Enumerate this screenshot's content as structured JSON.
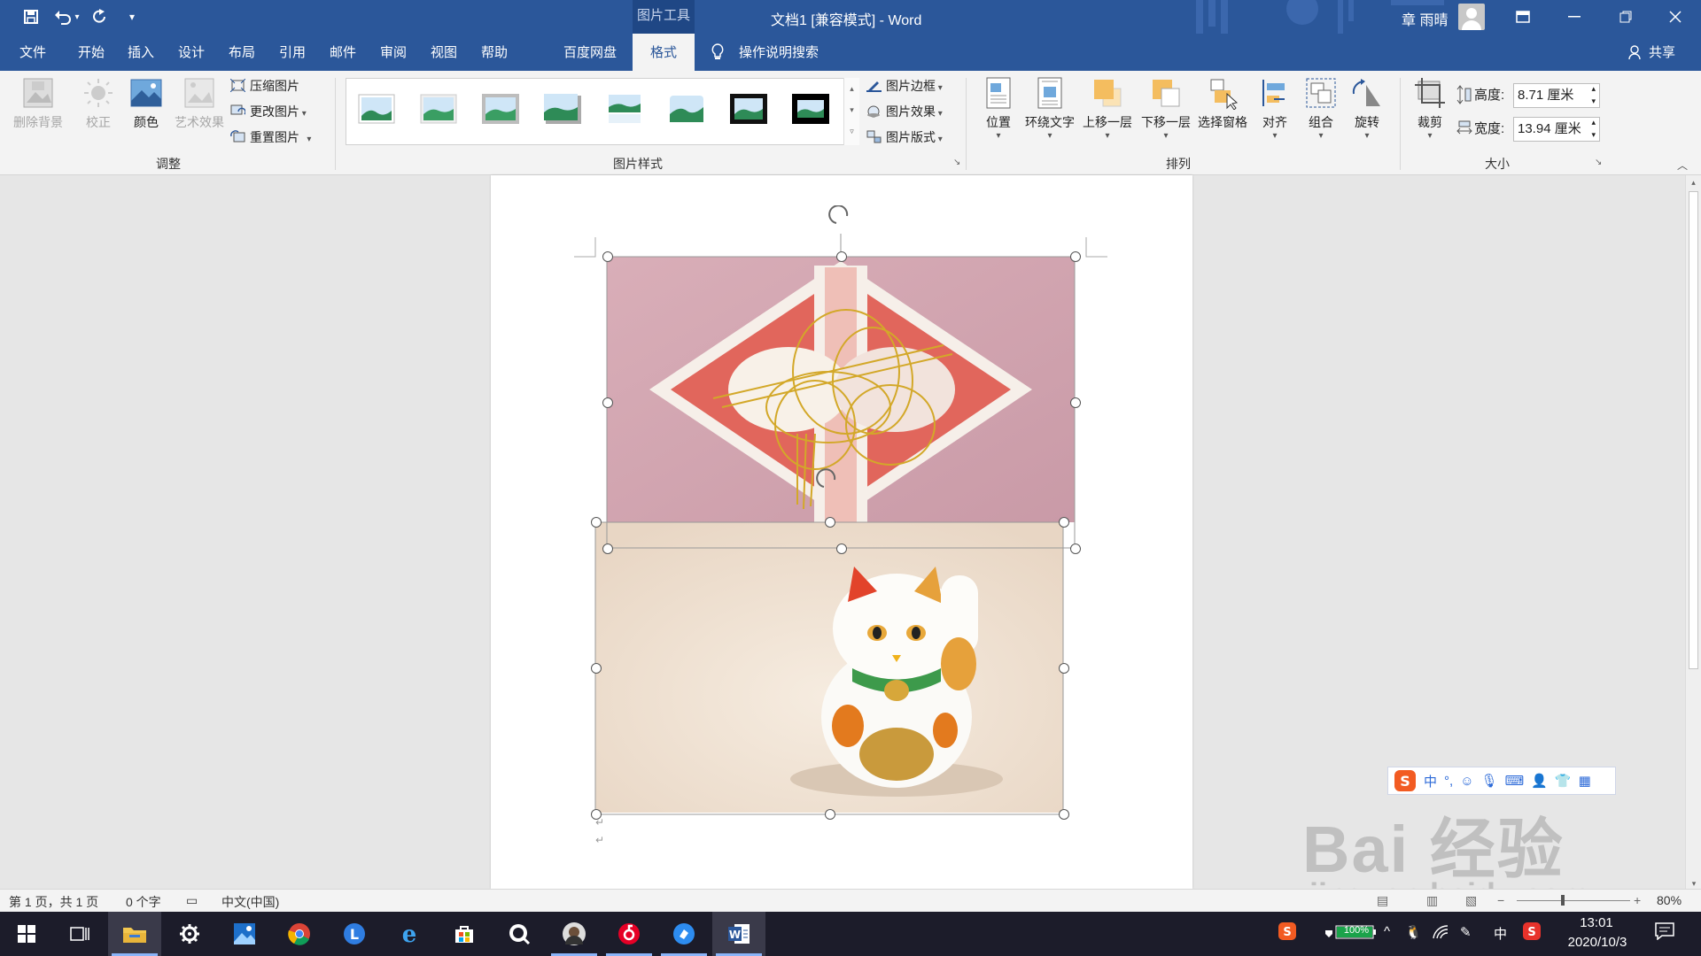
{
  "window": {
    "context_tab_label": "图片工具",
    "title": "文档1 [兼容模式] - Word",
    "user_name": "章 雨晴",
    "accent": "#2b579a"
  },
  "quick_access": [
    "save-icon",
    "undo-icon",
    "redo-icon",
    "customize-icon"
  ],
  "tabs": [
    {
      "label": "文件"
    },
    {
      "label": "开始"
    },
    {
      "label": "插入"
    },
    {
      "label": "设计"
    },
    {
      "label": "布局"
    },
    {
      "label": "引用"
    },
    {
      "label": "邮件"
    },
    {
      "label": "审阅"
    },
    {
      "label": "视图"
    },
    {
      "label": "帮助"
    },
    {
      "label": "百度网盘"
    },
    {
      "label": "格式"
    }
  ],
  "search_label": "操作说明搜索",
  "share_label": "共享",
  "ribbon": {
    "adjust": {
      "group_label": "调整",
      "remove_bg": "删除背景",
      "corrections": "校正",
      "color": "颜色",
      "artistic": "艺术效果",
      "compress": "压缩图片",
      "change": "更改图片",
      "reset": "重置图片"
    },
    "styles": {
      "group_label": "图片样式",
      "border": "图片边框",
      "effects": "图片效果",
      "layout": "图片版式"
    },
    "arrange": {
      "group_label": "排列",
      "position": "位置",
      "wrap": "环绕文字",
      "forward": "上移一层",
      "backward": "下移一层",
      "pane": "选择窗格",
      "align": "对齐",
      "group": "组合",
      "rotate": "旋转"
    },
    "size": {
      "group_label": "大小",
      "crop": "裁剪",
      "height_label": "高度:",
      "height_value": "8.71 厘米",
      "width_label": "宽度:",
      "width_value": "13.94 厘米"
    }
  },
  "status": {
    "page": "第 1 页，共 1 页",
    "words": "0 个字",
    "language": "中文(中国)",
    "zoom": "80%"
  },
  "ime": {
    "mode": "中"
  },
  "tray": {
    "battery": "100%",
    "ime_mode": "中",
    "time": "13:01",
    "date": "2020/10/3"
  },
  "watermark": {
    "main": "Bai 经验",
    "sub": "jingyan.baidu.com"
  }
}
